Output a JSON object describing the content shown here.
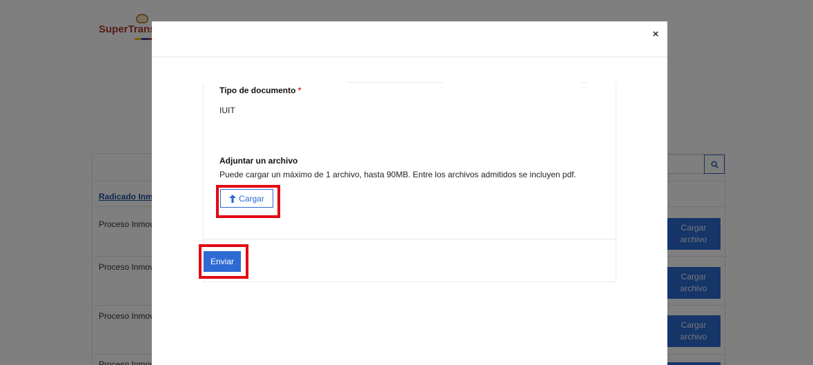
{
  "background": {
    "logo_text": "SuperTransporte",
    "column_header": "Radicado Inmovilizado",
    "rows": [
      {
        "text": "Proceso Inmovilización",
        "button": "Cargar archivo"
      },
      {
        "text": "Proceso Inmovilización",
        "button": "Cargar archivo"
      },
      {
        "text": "Proceso Inmovilización",
        "button": "Cargar archivo"
      },
      {
        "text": "Proceso Inmovilización"
      }
    ],
    "search_icon": "search-icon"
  },
  "modal": {
    "close_label": "×",
    "document_type": {
      "label": "Tipo de documento",
      "required_mark": "*",
      "value": "IUIT"
    },
    "attachment": {
      "title": "Adjuntar un archivo",
      "help": "Puede cargar un máximo de 1 archivo, hasta 90MB. Entre los archivos admitidos se incluyen pdf.",
      "upload_label": "Cargar",
      "upload_icon": "arrow-up-icon"
    },
    "submit_label": "Enviar"
  },
  "colors": {
    "accent": "#2d6ad3",
    "highlight": "#e30613",
    "required": "#d92b2b"
  }
}
